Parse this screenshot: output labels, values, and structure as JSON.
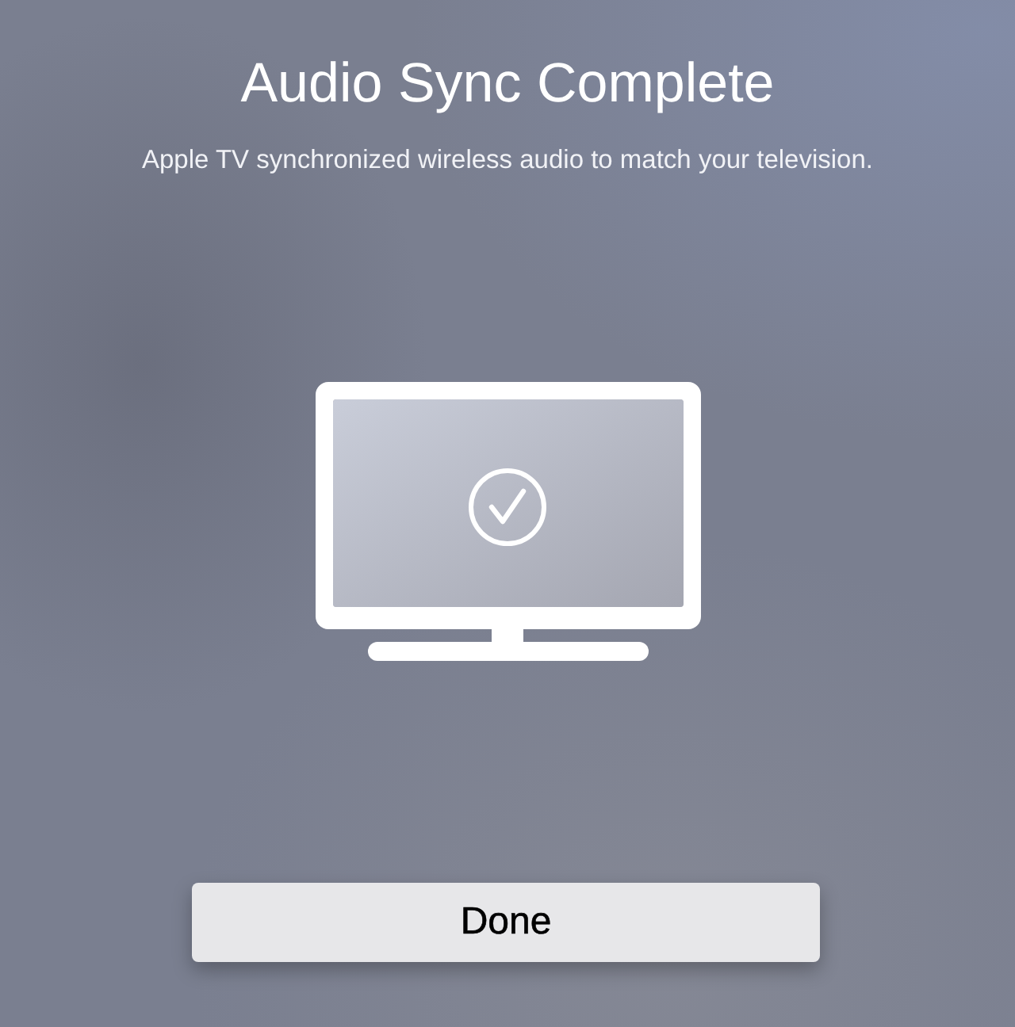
{
  "title": "Audio Sync Complete",
  "message": "Apple TV synchronized wireless audio to match your television.",
  "button": {
    "label": "Done"
  }
}
